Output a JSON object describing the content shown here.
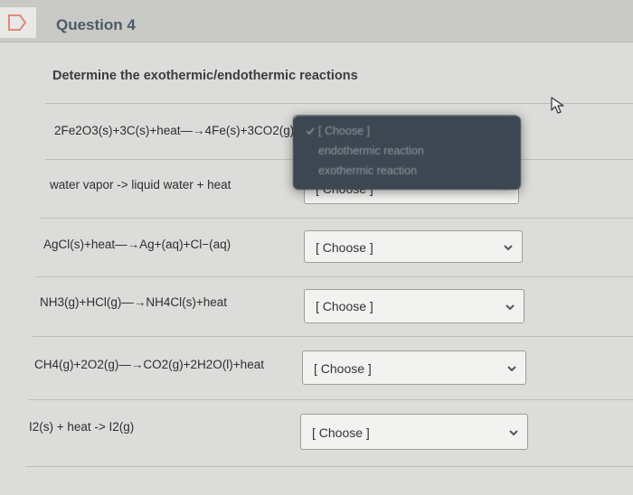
{
  "question": {
    "title": "Question 4"
  },
  "prompt": "Determine the exothermic/endothermic reactions",
  "rows": [
    {
      "label": "2Fe2O3(s)+3C(s)+heat—→4Fe(s)+3CO2(g)",
      "select": ""
    },
    {
      "label": "water vapor -> liquid water + heat",
      "select": "[ Choose ]"
    },
    {
      "label": "AgCl(s)+heat—→Ag+(aq)+Cl−(aq)",
      "select": "[ Choose ]"
    },
    {
      "label": "NH3(g)+HCl(g)—→NH4Cl(s)+heat",
      "select": "[ Choose ]"
    },
    {
      "label": "CH4(g)+2O2(g)—→CO2(g)+2H2O(l)+heat",
      "select": "[ Choose ]"
    },
    {
      "label": "I2(s) + heat -> I2(g)",
      "select": "[ Choose ]"
    }
  ],
  "dropdown": {
    "options": [
      "[ Choose ]",
      "endothermic reaction",
      "exothermic reaction"
    ]
  },
  "icons": {
    "flag": "flag-icon",
    "chevron": "chevron-down-icon",
    "check": "check-icon",
    "cursor": "pointer-cursor-icon"
  }
}
